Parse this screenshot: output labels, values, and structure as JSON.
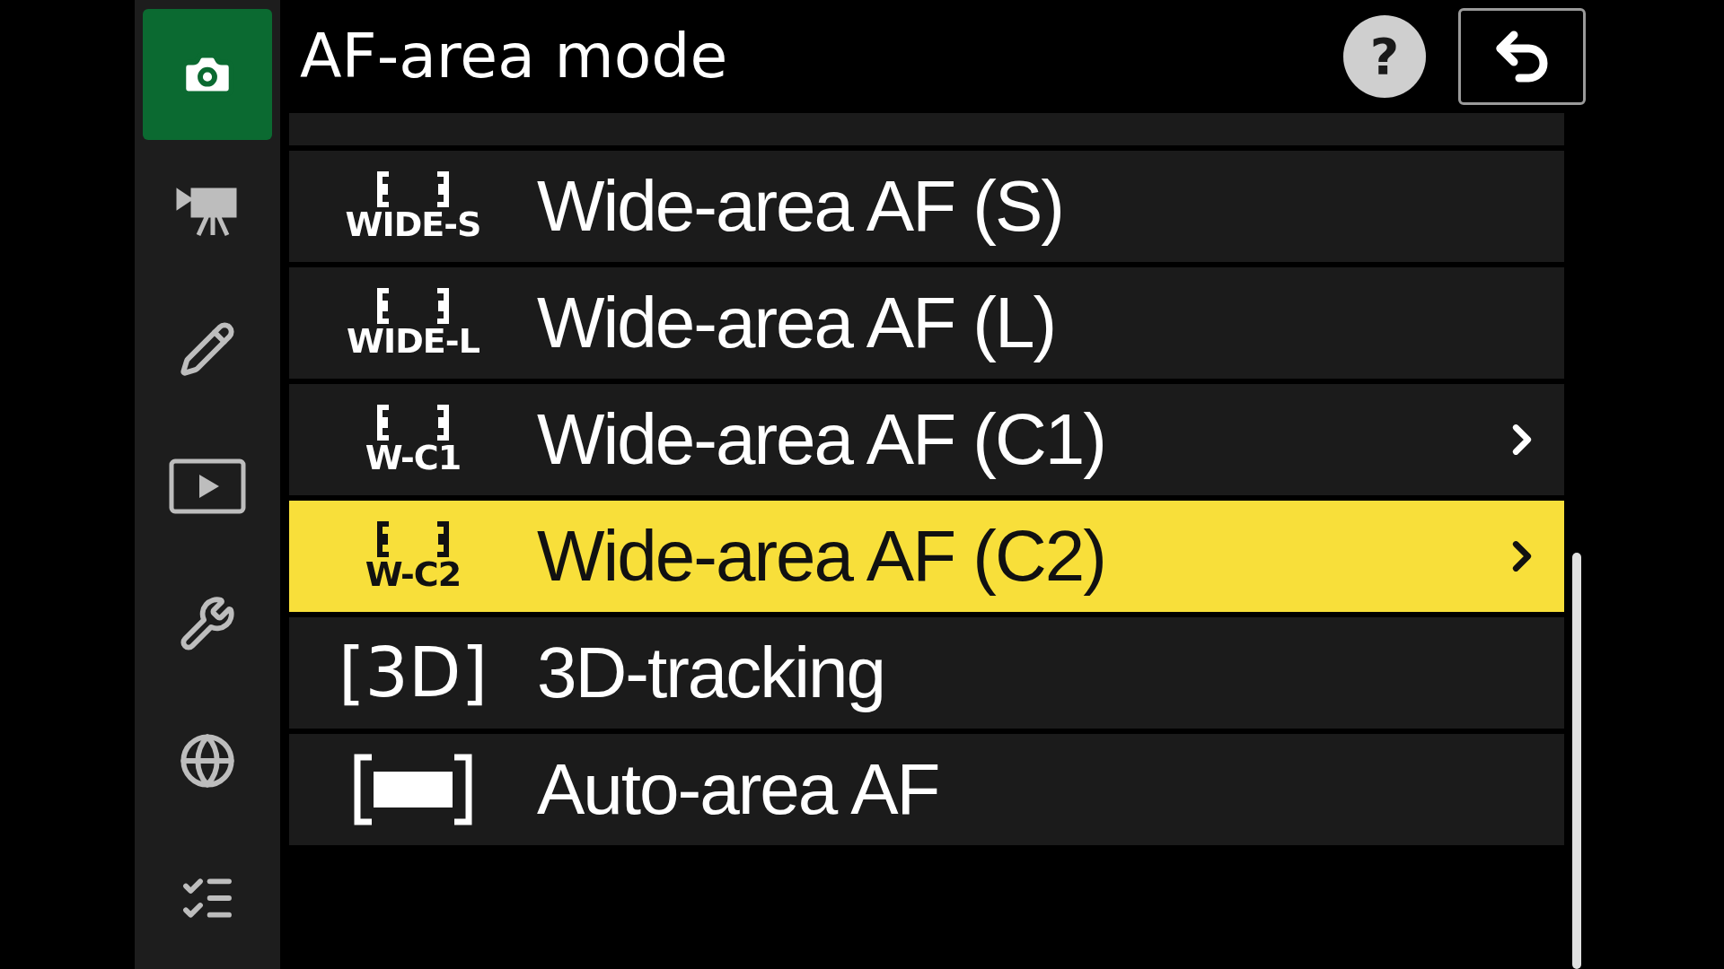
{
  "header": {
    "title": "AF-area mode",
    "help": "?"
  },
  "sidebar": {
    "items": [
      {
        "kind": "camera",
        "selected": true
      },
      {
        "kind": "movie",
        "selected": false
      },
      {
        "kind": "pencil",
        "selected": false
      },
      {
        "kind": "playback",
        "selected": false
      },
      {
        "kind": "wrench",
        "selected": false
      },
      {
        "kind": "network",
        "selected": false
      },
      {
        "kind": "checklist",
        "selected": false
      }
    ]
  },
  "menu": {
    "items": [
      {
        "kind": "sliver",
        "selected": false
      },
      {
        "kind": "wide",
        "label": "Wide-area AF (S)",
        "icon_text": "WIDE-S",
        "selected": false,
        "submenu": false
      },
      {
        "kind": "wide",
        "label": "Wide-area AF (L)",
        "icon_text": "WIDE-L",
        "selected": false,
        "submenu": false
      },
      {
        "kind": "wide",
        "label": "Wide-area AF (C1)",
        "icon_text": "W-C1",
        "selected": false,
        "submenu": true
      },
      {
        "kind": "wide",
        "label": "Wide-area AF (C2)",
        "icon_text": "W-C2",
        "selected": true,
        "submenu": true
      },
      {
        "kind": "tracking",
        "label": "3D-tracking",
        "icon_text": "[3D]",
        "selected": false,
        "submenu": false
      },
      {
        "kind": "auto",
        "label": "Auto-area AF",
        "selected": false,
        "submenu": false
      }
    ]
  }
}
